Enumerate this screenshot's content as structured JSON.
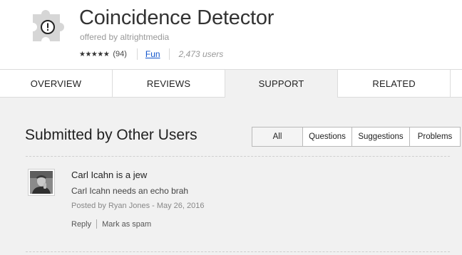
{
  "extension": {
    "name": "Coincidence Detector",
    "offered_by": "offered by altrightmedia",
    "stars": "★★★★★",
    "rating_count": "(94)",
    "category": "Fun",
    "users": "2,473 users",
    "icon": "puzzle-piece-icon"
  },
  "tabs": [
    {
      "label": "OVERVIEW"
    },
    {
      "label": "REVIEWS"
    },
    {
      "label": "SUPPORT",
      "active": true
    },
    {
      "label": "RELATED"
    }
  ],
  "support": {
    "section_title": "Submitted by Other Users",
    "filters": [
      {
        "label": "All",
        "active": true
      },
      {
        "label": "Questions"
      },
      {
        "label": "Suggestions"
      },
      {
        "label": "Problems"
      }
    ],
    "post": {
      "title": "Carl Icahn is a jew",
      "body": "Carl Icahn needs an echo brah",
      "meta": "Posted by Ryan Jones - May 26, 2016",
      "reply_label": "Reply",
      "spam_label": "Mark as spam"
    }
  },
  "colors": {
    "link": "#1155cc",
    "content_bg": "#f1f1f1",
    "puzzle": "#d6d6d6"
  }
}
